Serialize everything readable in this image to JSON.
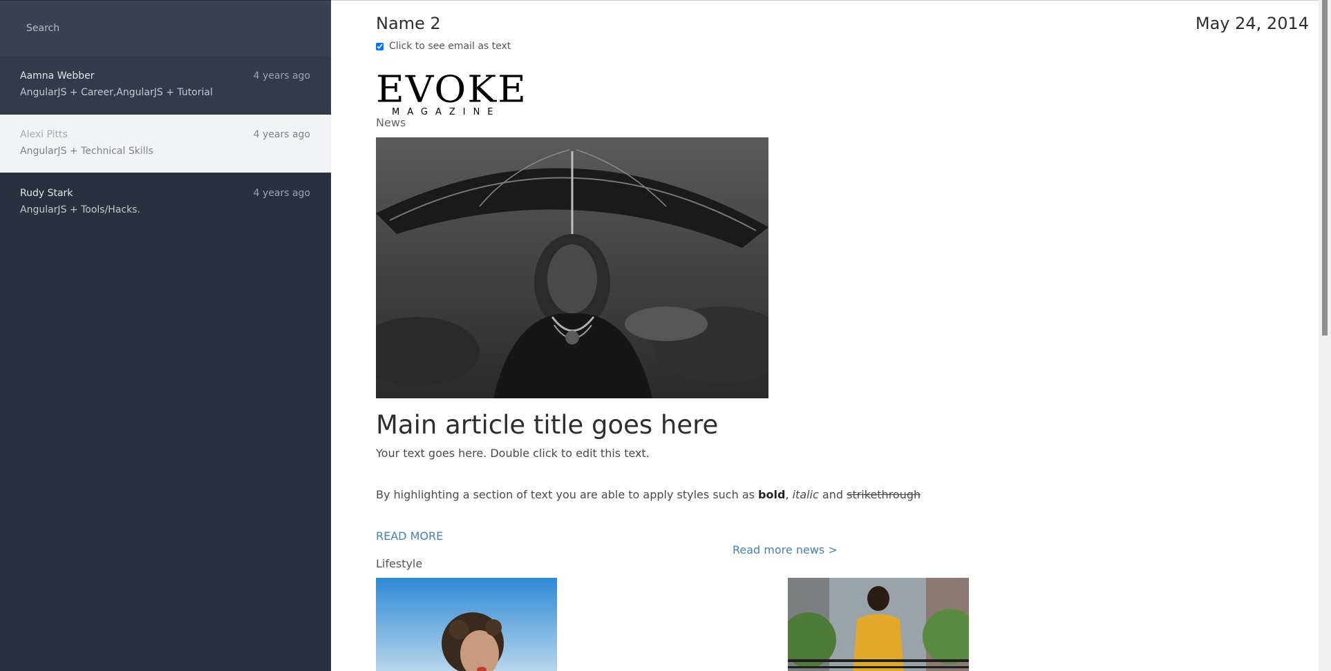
{
  "sidebar": {
    "search": {
      "placeholder": "Search"
    },
    "items": [
      {
        "sender": "Aamna Webber",
        "time": "4 years ago",
        "subject": "AngularJS + Career,AngularJS + Tutorial"
      },
      {
        "sender": "Alexi Pitts",
        "time": "4 years ago",
        "subject": "AngularJS + Technical Skills"
      },
      {
        "sender": "Rudy Stark",
        "time": "4 years ago",
        "subject": "AngularJS + Tools/Hacks."
      }
    ]
  },
  "email": {
    "name": "Name 2",
    "date": "May 24, 2014",
    "toggle_label": "Click to see email as text",
    "toggle_checked": true
  },
  "newsletter": {
    "logo": {
      "word": "EVOKE",
      "sub": "MAGAZINE"
    },
    "news_section": "News",
    "title": "Main article title goes here",
    "paragraph1": "Your text goes here. Double click to edit this text.",
    "paragraph2": {
      "prefix": "By highlighting a section of text you are able to apply styles such as ",
      "bold": "bold",
      "comma": ", ",
      "italic": "italic",
      "and": " and ",
      "strike": "strikethrough"
    },
    "read_more": "READ MORE",
    "read_more_news": "Read more news >",
    "lifestyle_section": "Lifestyle"
  },
  "colors": {
    "sidebar_bg": "#2b3040",
    "search_bg": "#3b4052",
    "link": "#4a7fb5"
  }
}
